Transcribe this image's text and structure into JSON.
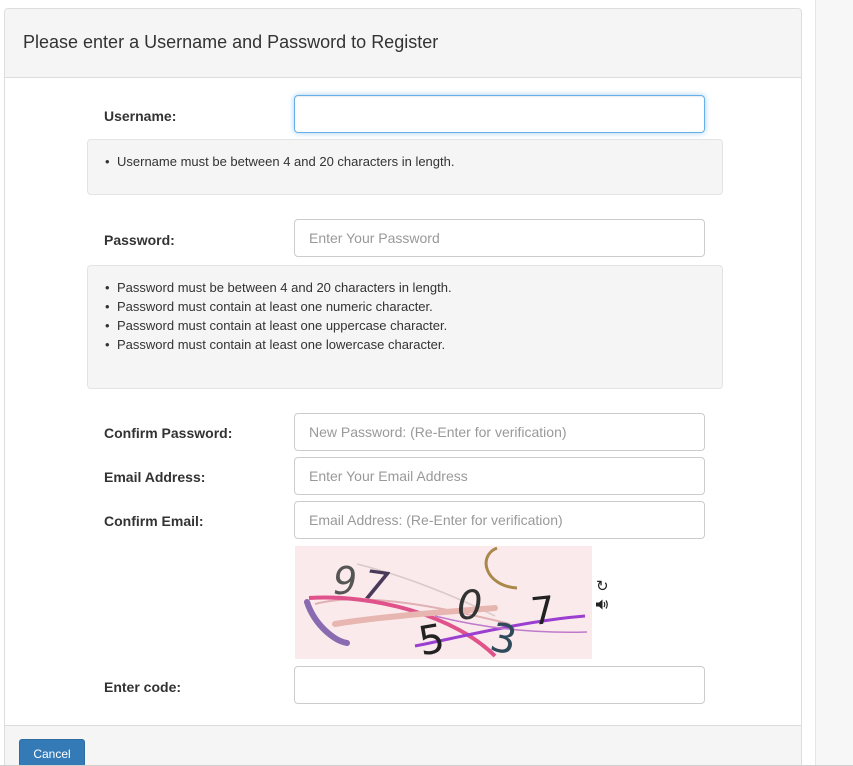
{
  "panel": {
    "title": "Please enter a Username and Password to Register"
  },
  "form": {
    "username": {
      "label": "Username:",
      "value": "",
      "placeholder": ""
    },
    "username_rules": [
      "Username must be between 4 and 20 characters in length."
    ],
    "password": {
      "label": "Password:",
      "placeholder": "Enter Your Password"
    },
    "password_rules": [
      "Password must be between 4 and 20 characters in length.",
      "Password must contain at least one numeric character.",
      "Password must contain at least one uppercase character.",
      "Password must contain at least one lowercase character."
    ],
    "confirm_password": {
      "label": "Confirm Password:",
      "placeholder": "New Password: (Re-Enter for verification)"
    },
    "email": {
      "label": "Email Address:",
      "placeholder": "Enter Your Email Address"
    },
    "confirm_email": {
      "label": "Confirm Email:",
      "placeholder": "Email Address: (Re-Enter for verification)"
    },
    "captcha": {
      "characters": [
        "9",
        "7",
        "0",
        "7",
        "5",
        "3"
      ],
      "refresh_icon": "refresh-icon",
      "audio_icon": "speaker-icon"
    },
    "enter_code": {
      "label": "Enter code:",
      "value": ""
    }
  },
  "footer": {
    "cancel_label": "Cancel"
  },
  "colors": {
    "primary": "#337ab7",
    "focus": "#66afe9",
    "well": "#f5f5f5",
    "captcha_bg": "#fbeaec"
  }
}
